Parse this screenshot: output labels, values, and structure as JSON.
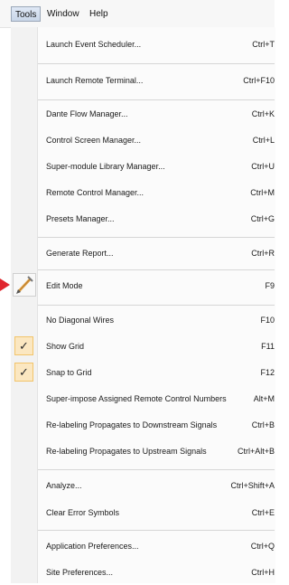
{
  "menubar": {
    "tools": "Tools",
    "window": "Window",
    "help": "Help"
  },
  "menu": {
    "items": [
      {
        "label": "Launch Event Scheduler...",
        "shortcut": "Ctrl+T"
      },
      {
        "label": "Launch Remote Terminal...",
        "shortcut": "Ctrl+F10"
      },
      {
        "label": "Dante Flow Manager...",
        "shortcut": "Ctrl+K"
      },
      {
        "label": "Control Screen Manager...",
        "shortcut": "Ctrl+L"
      },
      {
        "label": "Super-module Library Manager...",
        "shortcut": "Ctrl+U"
      },
      {
        "label": "Remote Control Manager...",
        "shortcut": "Ctrl+M"
      },
      {
        "label": "Presets Manager...",
        "shortcut": "Ctrl+G"
      },
      {
        "label": "Generate Report...",
        "shortcut": "Ctrl+R"
      },
      {
        "label": "Edit Mode",
        "shortcut": "F9"
      },
      {
        "label": "No Diagonal Wires",
        "shortcut": "F10"
      },
      {
        "label": "Show Grid",
        "shortcut": "F11",
        "checked": true
      },
      {
        "label": "Snap to Grid",
        "shortcut": "F12",
        "checked": true
      },
      {
        "label": "Super-impose Assigned Remote Control Numbers",
        "shortcut": "Alt+M"
      },
      {
        "label": "Re-labeling Propagates to Downstream Signals",
        "shortcut": "Ctrl+B"
      },
      {
        "label": "Re-labeling Propagates to Upstream Signals",
        "shortcut": "Ctrl+Alt+B"
      },
      {
        "label": "Analyze...",
        "shortcut": "Ctrl+Shift+A"
      },
      {
        "label": "Clear Error Symbols",
        "shortcut": "Ctrl+E"
      },
      {
        "label": "Application Preferences...",
        "shortcut": "Ctrl+Q"
      },
      {
        "label": "Site Preferences...",
        "shortcut": "Ctrl+H"
      }
    ],
    "check_glyph": "✓"
  },
  "colors": {
    "arrow": "#e0262e",
    "check_highlight": "#fbe7c1",
    "active_menu": "#c9d6e8"
  },
  "icons": {
    "edit_mode": "pencil-icon",
    "pointer": "red-arrow-icon"
  }
}
